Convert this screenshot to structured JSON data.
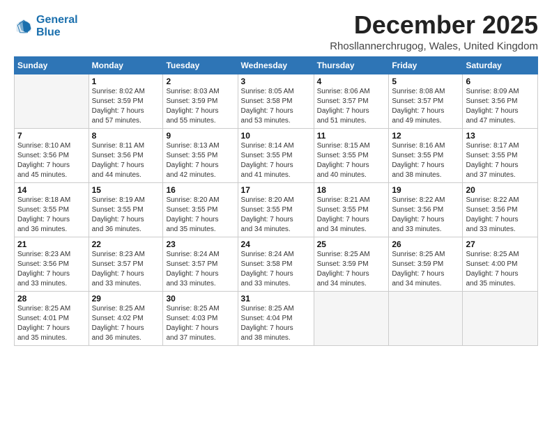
{
  "logo": {
    "line1": "General",
    "line2": "Blue"
  },
  "title": "December 2025",
  "location": "Rhosllannerchrugog, Wales, United Kingdom",
  "days_header": [
    "Sunday",
    "Monday",
    "Tuesday",
    "Wednesday",
    "Thursday",
    "Friday",
    "Saturday"
  ],
  "weeks": [
    [
      {
        "day": "",
        "info": ""
      },
      {
        "day": "1",
        "info": "Sunrise: 8:02 AM\nSunset: 3:59 PM\nDaylight: 7 hours\nand 57 minutes."
      },
      {
        "day": "2",
        "info": "Sunrise: 8:03 AM\nSunset: 3:59 PM\nDaylight: 7 hours\nand 55 minutes."
      },
      {
        "day": "3",
        "info": "Sunrise: 8:05 AM\nSunset: 3:58 PM\nDaylight: 7 hours\nand 53 minutes."
      },
      {
        "day": "4",
        "info": "Sunrise: 8:06 AM\nSunset: 3:57 PM\nDaylight: 7 hours\nand 51 minutes."
      },
      {
        "day": "5",
        "info": "Sunrise: 8:08 AM\nSunset: 3:57 PM\nDaylight: 7 hours\nand 49 minutes."
      },
      {
        "day": "6",
        "info": "Sunrise: 8:09 AM\nSunset: 3:56 PM\nDaylight: 7 hours\nand 47 minutes."
      }
    ],
    [
      {
        "day": "7",
        "info": "Sunrise: 8:10 AM\nSunset: 3:56 PM\nDaylight: 7 hours\nand 45 minutes."
      },
      {
        "day": "8",
        "info": "Sunrise: 8:11 AM\nSunset: 3:56 PM\nDaylight: 7 hours\nand 44 minutes."
      },
      {
        "day": "9",
        "info": "Sunrise: 8:13 AM\nSunset: 3:55 PM\nDaylight: 7 hours\nand 42 minutes."
      },
      {
        "day": "10",
        "info": "Sunrise: 8:14 AM\nSunset: 3:55 PM\nDaylight: 7 hours\nand 41 minutes."
      },
      {
        "day": "11",
        "info": "Sunrise: 8:15 AM\nSunset: 3:55 PM\nDaylight: 7 hours\nand 40 minutes."
      },
      {
        "day": "12",
        "info": "Sunrise: 8:16 AM\nSunset: 3:55 PM\nDaylight: 7 hours\nand 38 minutes."
      },
      {
        "day": "13",
        "info": "Sunrise: 8:17 AM\nSunset: 3:55 PM\nDaylight: 7 hours\nand 37 minutes."
      }
    ],
    [
      {
        "day": "14",
        "info": "Sunrise: 8:18 AM\nSunset: 3:55 PM\nDaylight: 7 hours\nand 36 minutes."
      },
      {
        "day": "15",
        "info": "Sunrise: 8:19 AM\nSunset: 3:55 PM\nDaylight: 7 hours\nand 36 minutes."
      },
      {
        "day": "16",
        "info": "Sunrise: 8:20 AM\nSunset: 3:55 PM\nDaylight: 7 hours\nand 35 minutes."
      },
      {
        "day": "17",
        "info": "Sunrise: 8:20 AM\nSunset: 3:55 PM\nDaylight: 7 hours\nand 34 minutes."
      },
      {
        "day": "18",
        "info": "Sunrise: 8:21 AM\nSunset: 3:55 PM\nDaylight: 7 hours\nand 34 minutes."
      },
      {
        "day": "19",
        "info": "Sunrise: 8:22 AM\nSunset: 3:56 PM\nDaylight: 7 hours\nand 33 minutes."
      },
      {
        "day": "20",
        "info": "Sunrise: 8:22 AM\nSunset: 3:56 PM\nDaylight: 7 hours\nand 33 minutes."
      }
    ],
    [
      {
        "day": "21",
        "info": "Sunrise: 8:23 AM\nSunset: 3:56 PM\nDaylight: 7 hours\nand 33 minutes."
      },
      {
        "day": "22",
        "info": "Sunrise: 8:23 AM\nSunset: 3:57 PM\nDaylight: 7 hours\nand 33 minutes."
      },
      {
        "day": "23",
        "info": "Sunrise: 8:24 AM\nSunset: 3:57 PM\nDaylight: 7 hours\nand 33 minutes."
      },
      {
        "day": "24",
        "info": "Sunrise: 8:24 AM\nSunset: 3:58 PM\nDaylight: 7 hours\nand 33 minutes."
      },
      {
        "day": "25",
        "info": "Sunrise: 8:25 AM\nSunset: 3:59 PM\nDaylight: 7 hours\nand 34 minutes."
      },
      {
        "day": "26",
        "info": "Sunrise: 8:25 AM\nSunset: 3:59 PM\nDaylight: 7 hours\nand 34 minutes."
      },
      {
        "day": "27",
        "info": "Sunrise: 8:25 AM\nSunset: 4:00 PM\nDaylight: 7 hours\nand 35 minutes."
      }
    ],
    [
      {
        "day": "28",
        "info": "Sunrise: 8:25 AM\nSunset: 4:01 PM\nDaylight: 7 hours\nand 35 minutes."
      },
      {
        "day": "29",
        "info": "Sunrise: 8:25 AM\nSunset: 4:02 PM\nDaylight: 7 hours\nand 36 minutes."
      },
      {
        "day": "30",
        "info": "Sunrise: 8:25 AM\nSunset: 4:03 PM\nDaylight: 7 hours\nand 37 minutes."
      },
      {
        "day": "31",
        "info": "Sunrise: 8:25 AM\nSunset: 4:04 PM\nDaylight: 7 hours\nand 38 minutes."
      },
      {
        "day": "",
        "info": ""
      },
      {
        "day": "",
        "info": ""
      },
      {
        "day": "",
        "info": ""
      }
    ]
  ]
}
